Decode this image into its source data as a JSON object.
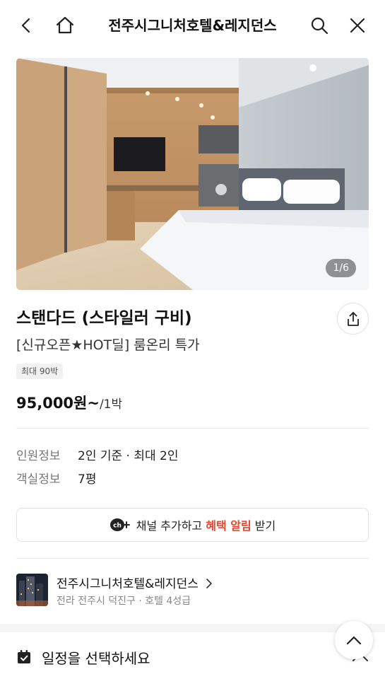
{
  "header": {
    "title": "전주시그니처호텔&레지던스",
    "icons": [
      "back-icon",
      "home-icon",
      "search-icon",
      "close-icon"
    ]
  },
  "gallery": {
    "counter": "1/6",
    "current": 1,
    "total": 6
  },
  "room": {
    "name": "스탠다드 (스타일러 구비)",
    "subtitle": "[신규오픈★HOT딜] 룸온리 특가",
    "badge": "최대 90박",
    "price": "95,000원~",
    "price_unit": "/1박"
  },
  "info": {
    "rows": [
      {
        "key": "인원정보",
        "value": "2인 기준 · 최대 2인"
      },
      {
        "key": "객실정보",
        "value": "7평"
      }
    ]
  },
  "kakao_channel": {
    "icon_text": "ch",
    "text_before": "채널 추가하고 ",
    "highlight": "혜택 알림",
    "text_after": " 받기",
    "accent_color": "#e8452c"
  },
  "hotel": {
    "name": "전주시그니처호텔&레지던스",
    "meta": "전라 전주시 덕진구 · 호텔 4성급"
  },
  "schedule": {
    "label": "일정을 선택하세요"
  }
}
